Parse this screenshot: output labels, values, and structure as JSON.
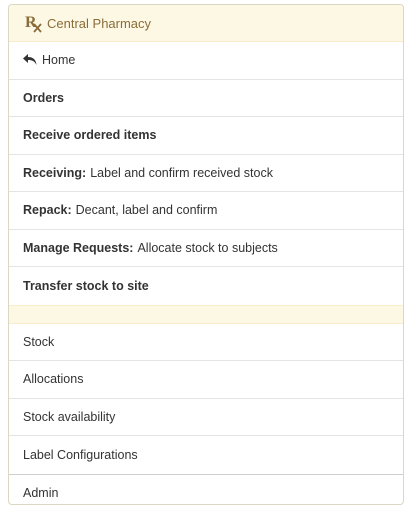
{
  "header": {
    "title": "Central Pharmacy",
    "icon": "rx-icon"
  },
  "nav": {
    "home": "Home",
    "orders": "Orders",
    "receive_ordered": "Receive ordered items",
    "receiving_bold": "Receiving:",
    "receiving_text": "Label and confirm received stock",
    "repack_bold": "Repack:",
    "repack_text": "Decant, label and confirm",
    "manage_bold": "Manage Requests:",
    "manage_text": "Allocate stock to subjects",
    "transfer": "Transfer stock to site"
  },
  "secondary": {
    "stock": "Stock",
    "allocations": "Allocations",
    "availability": "Stock availability",
    "label_configs": "Label Configurations",
    "admin": "Admin"
  }
}
